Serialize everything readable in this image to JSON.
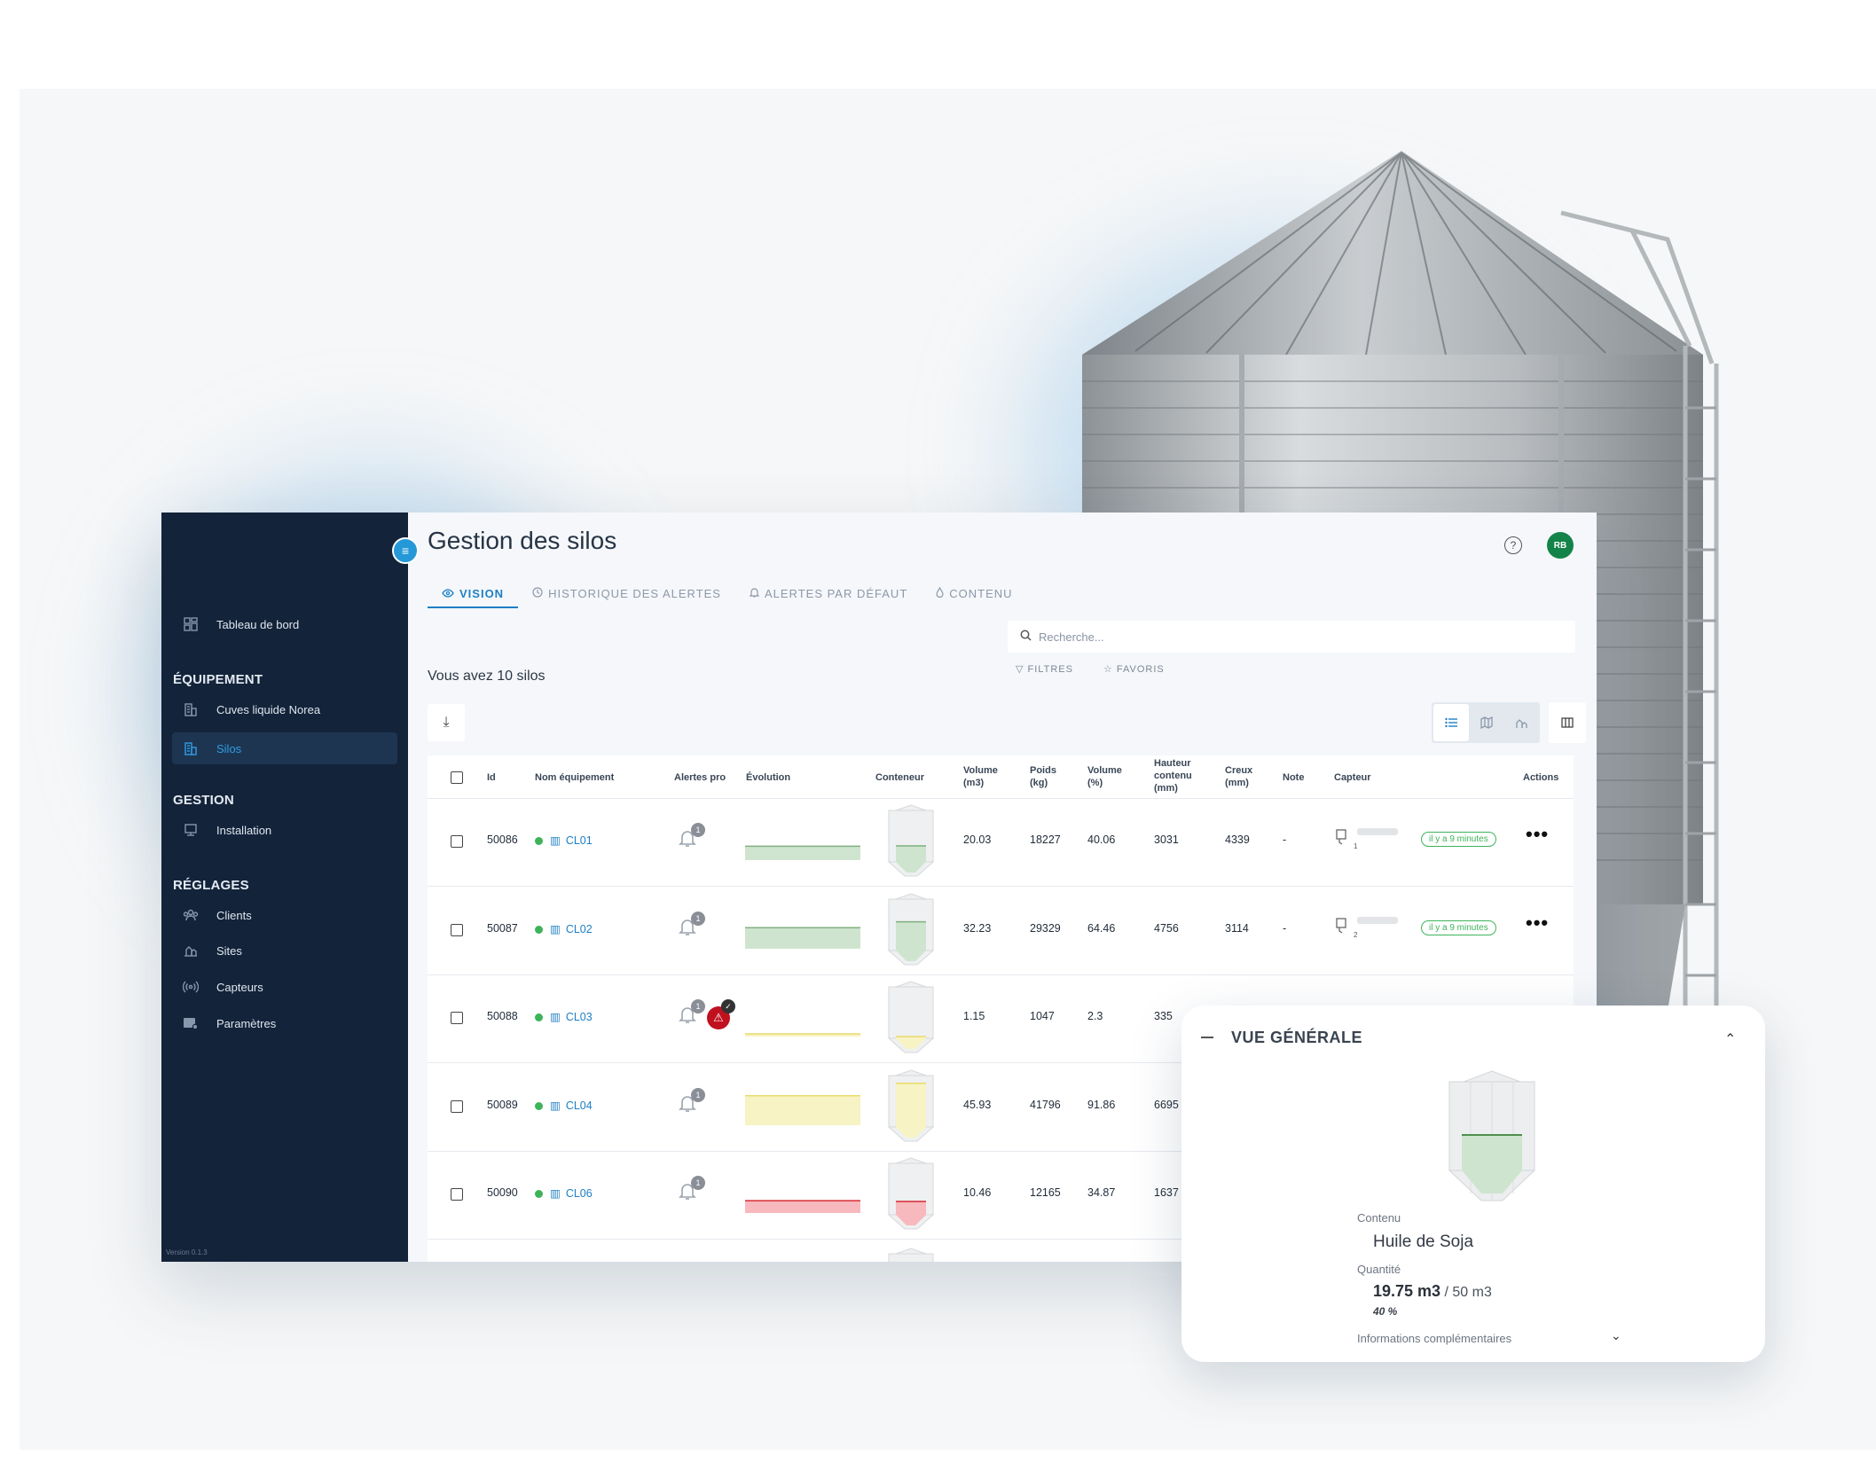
{
  "app": {
    "title": "Gestion des silos",
    "avatar_initials": "RB",
    "help_icon": "question-circle-icon"
  },
  "sidebar": {
    "dashboard": "Tableau de bord",
    "sections": [
      {
        "heading": "ÉQUIPEMENT",
        "items": [
          "Cuves liquide Norea",
          "Silos"
        ]
      },
      {
        "heading": "GESTION",
        "items": [
          "Installation"
        ]
      },
      {
        "heading": "RÉGLAGES",
        "items": [
          "Clients",
          "Sites",
          "Capteurs",
          "Paramètres"
        ]
      }
    ],
    "active_item": "Silos",
    "version": "Version 0.1.3"
  },
  "tabs": [
    {
      "label": "VISION",
      "active": true
    },
    {
      "label": "HISTORIQUE DES ALERTES",
      "active": false
    },
    {
      "label": "ALERTES PAR DÉFAUT",
      "active": false
    },
    {
      "label": "CONTENU",
      "active": false
    }
  ],
  "search": {
    "placeholder": "Recherche..."
  },
  "filters": {
    "filters_label": "FILTRES",
    "favorites_label": "FAVORIS"
  },
  "summary": {
    "count_text": "Vous avez 10 silos"
  },
  "table": {
    "headers": [
      "Id",
      "Nom équipement",
      "Alertes pro",
      "Évolution",
      "Conteneur",
      "Volume (m3)",
      "Poids (kg)",
      "Volume (%)",
      "Hauteur contenu (mm)",
      "Creux (mm)",
      "Note",
      "Capteur",
      "Actions"
    ],
    "rows": [
      {
        "id": "50086",
        "name": "CL01",
        "alerts": "1",
        "critical": false,
        "volume_m3": "20.03",
        "weight_kg": "18227",
        "volume_pct": "40.06",
        "height_mm": "3031",
        "hollow_mm": "4339",
        "note": "-",
        "sensor_index": "1",
        "last_seen": "il y a 9 minutes",
        "level_color": "#cfe4cf",
        "level_line": "#7fb07f",
        "level": 0.4
      },
      {
        "id": "50087",
        "name": "CL02",
        "alerts": "1",
        "critical": false,
        "volume_m3": "32.23",
        "weight_kg": "29329",
        "volume_pct": "64.46",
        "height_mm": "4756",
        "hollow_mm": "3114",
        "note": "-",
        "sensor_index": "2",
        "last_seen": "il y a 9 minutes",
        "level_color": "#cfe4cf",
        "level_line": "#7fb07f",
        "level": 0.64
      },
      {
        "id": "50088",
        "name": "CL03",
        "alerts": "1",
        "critical": true,
        "critical_badge": "✓",
        "volume_m3": "1.15",
        "weight_kg": "1047",
        "volume_pct": "2.3",
        "height_mm": "335",
        "level_color": "#f7f3c4",
        "level_line": "#e8dc6a",
        "level": 0.02
      },
      {
        "id": "50089",
        "name": "CL04",
        "alerts": "1",
        "critical": false,
        "volume_m3": "45.93",
        "weight_kg": "41796",
        "volume_pct": "91.86",
        "height_mm": "6695",
        "level_color": "#f7f3c4",
        "level_line": "#e8dc6a",
        "level": 0.92
      },
      {
        "id": "50090",
        "name": "CL06",
        "alerts": "1",
        "critical": false,
        "volume_m3": "10.46",
        "weight_kg": "12165",
        "volume_pct": "34.87",
        "height_mm": "1637",
        "level_color": "#f7b9bd",
        "level_line": "#d62a35",
        "level": 0.35
      }
    ]
  },
  "overview": {
    "title": "VUE GÉNÉRALE",
    "content_label": "Contenu",
    "content_value": "Huile de Soja",
    "quantity_label": "Quantité",
    "quantity_value": "19.75 m3",
    "quantity_total": "/ 50 m3",
    "quantity_pct": "40 %",
    "level": 0.4,
    "more_label": "Informations complémentaires"
  },
  "colors": {
    "sidebar_bg": "#13233a",
    "accent": "#1d7fc4",
    "status_ok": "#3db35a",
    "critical": "#c0111f"
  }
}
